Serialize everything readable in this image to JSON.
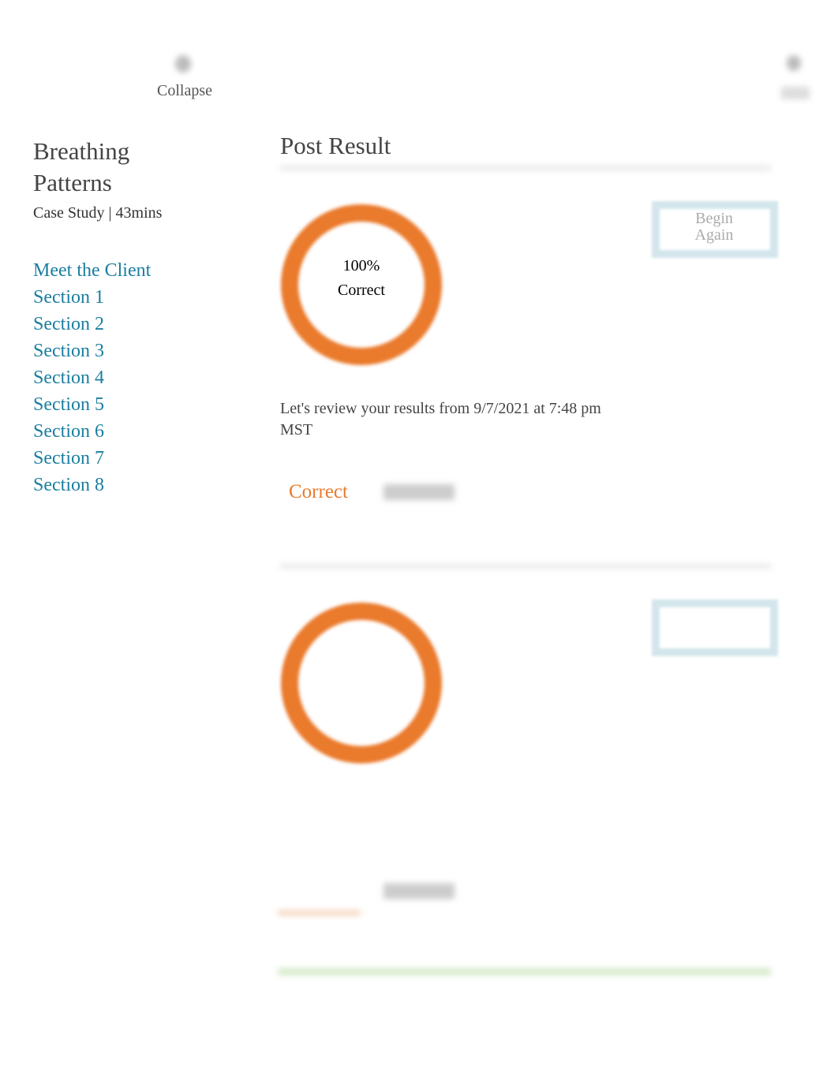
{
  "header": {
    "collapse_label": "Collapse"
  },
  "sidebar": {
    "title": "Breathing Patterns",
    "subtitle": "Case Study | 43mins",
    "items": [
      "Meet the Client",
      "Section 1",
      "Section 2",
      "Section 3",
      "Section 4",
      "Section 5",
      "Section 6",
      "Section 7",
      "Section 8"
    ]
  },
  "main": {
    "title": "Post Result",
    "score": "100%",
    "score_label": "Correct",
    "begin_again": "Begin Again",
    "review_text": "Let's review your results from 9/7/2021 at 7:48 pm MST",
    "tabs": [
      "Correct"
    ]
  },
  "colors": {
    "accent": "#ea7a2c",
    "link": "#1a7ea0"
  }
}
